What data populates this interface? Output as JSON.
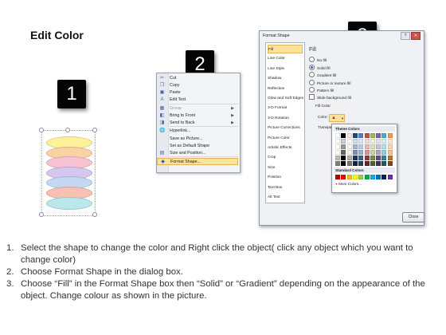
{
  "title": "Edit Color",
  "badges": [
    "1",
    "2",
    "3"
  ],
  "stack_colors": [
    "#fdf29a",
    "#f9d3a4",
    "#f7c3d3",
    "#d7c6ee",
    "#c4d8f4",
    "#f7c0b0",
    "#b9e7ea"
  ],
  "context_menu": {
    "items": [
      {
        "label": "Cut",
        "icon": "scissors-icon",
        "glyph": "✂",
        "disabled": false,
        "arrow": false
      },
      {
        "label": "Copy",
        "icon": "copy-icon",
        "glyph": "❐",
        "disabled": false,
        "arrow": false
      },
      {
        "label": "Paste",
        "icon": "paste-icon",
        "glyph": "▣",
        "disabled": false,
        "arrow": false
      },
      {
        "label": "Edit Text",
        "icon": "edit-text-icon",
        "glyph": "A",
        "disabled": false,
        "arrow": false
      },
      {
        "label": "Group",
        "icon": "group-icon",
        "glyph": "▦",
        "disabled": true,
        "arrow": true
      },
      {
        "label": "Bring to Front",
        "icon": "bring-front-icon",
        "glyph": "◧",
        "disabled": false,
        "arrow": true
      },
      {
        "label": "Send to Back",
        "icon": "send-back-icon",
        "glyph": "◨",
        "disabled": false,
        "arrow": true
      },
      {
        "label": "Hyperlink...",
        "icon": "hyperlink-icon",
        "glyph": "🌐",
        "disabled": false,
        "arrow": false
      },
      {
        "label": "Save as Picture...",
        "icon": "",
        "glyph": "",
        "disabled": false,
        "arrow": false
      },
      {
        "label": "Set as Default Shape",
        "icon": "",
        "glyph": "",
        "disabled": false,
        "arrow": false
      },
      {
        "label": "Size and Position...",
        "icon": "size-position-icon",
        "glyph": "▤",
        "disabled": false,
        "arrow": false
      },
      {
        "label": "Format Shape...",
        "icon": "format-shape-icon",
        "glyph": "◆",
        "disabled": false,
        "arrow": false
      }
    ]
  },
  "dialog": {
    "title": "Format Shape",
    "left_items": [
      "Fill",
      "Line Color",
      "Line Style",
      "Shadow",
      "Reflection",
      "Glow and Soft Edges",
      "3-D Format",
      "3-D Rotation",
      "Picture Corrections",
      "Picture Color",
      "Artistic Effects",
      "Crop",
      "Size",
      "Position",
      "Text Box",
      "Alt Text"
    ],
    "pane_title": "Fill",
    "fill_options": [
      {
        "label": "No fill",
        "selected": false
      },
      {
        "label": "Solid fill",
        "selected": true
      },
      {
        "label": "Gradient fill",
        "selected": false
      },
      {
        "label": "Picture or texture fill",
        "selected": false
      },
      {
        "label": "Pattern fill",
        "selected": false
      }
    ],
    "slide_bg": "Slide background fill",
    "fill_color": "Fill Color",
    "color_label": "Color:",
    "transparency_label": "Transpa",
    "close_label": "Close"
  },
  "palette": {
    "theme_header": "Theme Colors",
    "standard_header": "Standard Colors",
    "more": "More Colors...",
    "theme_top": [
      "#ffffff",
      "#000000",
      "#eeece1",
      "#1f497d",
      "#4f81bd",
      "#c0504d",
      "#9bbb59",
      "#8064a2",
      "#4bacc6",
      "#f79646"
    ],
    "standard": [
      "#c00000",
      "#ff0000",
      "#ffc000",
      "#ffff00",
      "#92d050",
      "#00b050",
      "#00b0f0",
      "#0070c0",
      "#002060",
      "#7030a0"
    ]
  },
  "steps": [
    {
      "num": "1.",
      "text": "Select the shape to change the color and Right click the object( click any object which you want to change color)"
    },
    {
      "num": "2.",
      "text": "Choose Format Shape in the dialog box."
    },
    {
      "num": "3.",
      "text": "Choose “Fill” in the Format Shape box then “Solid” or “Gradient” depending on the appearance of the object. Change colour as shown in the picture."
    }
  ]
}
